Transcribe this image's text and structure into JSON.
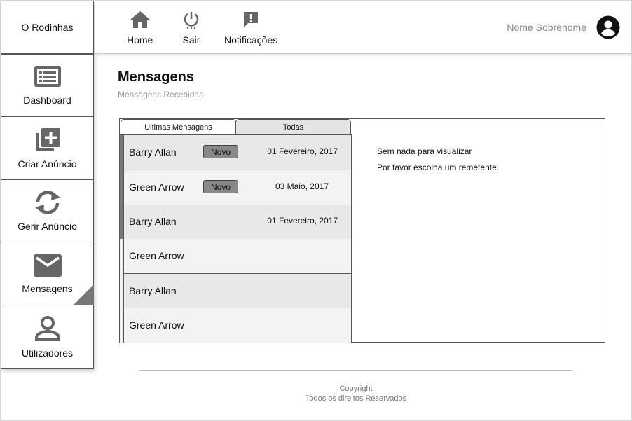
{
  "app": {
    "brand": "O Rodinhas"
  },
  "sidebar": {
    "items": [
      {
        "label": "Dashboard",
        "icon": "dashboard-icon"
      },
      {
        "label": "Criar Anúncio",
        "icon": "add-ad-icon"
      },
      {
        "label": "Gerir Anúncio",
        "icon": "sync-icon"
      },
      {
        "label": "Mensagens",
        "icon": "mail-icon",
        "active": true
      },
      {
        "label": "Utilizadores",
        "icon": "user-icon"
      }
    ]
  },
  "topnav": {
    "items": [
      {
        "label": "Home",
        "icon": "home-icon"
      },
      {
        "label": "Sair",
        "icon": "power-icon"
      },
      {
        "label": "Notificações",
        "icon": "notification-icon"
      }
    ],
    "user_name": "Nome Sobrenome",
    "user_icon": "account-circle-icon"
  },
  "page": {
    "title": "Mensagens",
    "subtitle": "Mensagens Recebidas"
  },
  "messages": {
    "tabs": [
      {
        "label": "Ultimas Mensagens",
        "active": true
      },
      {
        "label": "Todas",
        "active": false
      }
    ],
    "rows": [
      {
        "sender": "Barry Allan",
        "badge": "Novo",
        "date": "01 Fevereiro, 2017"
      },
      {
        "sender": "Green Arrow",
        "badge": "Novo",
        "date": "03 Maio, 2017"
      },
      {
        "sender": "Barry Allan",
        "badge": "",
        "date": "01 Fevereiro, 2017"
      },
      {
        "sender": "Green Arrow",
        "badge": "",
        "date": ""
      },
      {
        "sender": "Barry Allan",
        "badge": "",
        "date": ""
      },
      {
        "sender": "Green Arrow",
        "badge": "",
        "date": ""
      }
    ],
    "empty_title": "Sem nada para visualizar",
    "empty_hint": "Por favor escolha um remetente."
  },
  "footer": {
    "line1": "Copyright",
    "line2": "Todos os direitos Reservados"
  },
  "colors": {
    "icon": "#666666",
    "badge": "#888888",
    "border": "#555555"
  }
}
